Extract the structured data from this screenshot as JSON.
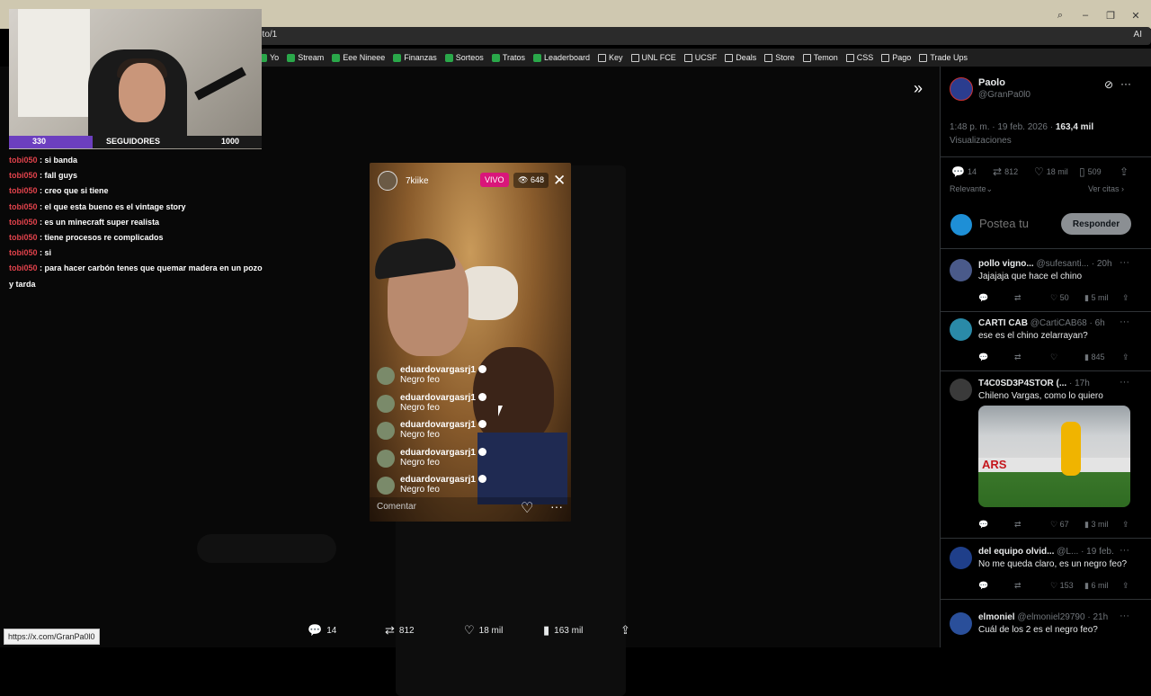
{
  "browser": {
    "url_fragment": "oto/1",
    "ai_label": "AI",
    "bookmarks": [
      "Yo",
      "Stream",
      "Eee Nineee",
      "Finanzas",
      "Sorteos",
      "Tratos",
      "Leaderboard",
      "Key",
      "UNL FCE",
      "UCSF",
      "Deals",
      "Store",
      "Temon",
      "CSS",
      "Pago",
      "Trade Ups"
    ],
    "status_url": "https://x.com/GranPa0l0"
  },
  "stream": {
    "followers_current": "330",
    "followers_label": "SEGUIDORES",
    "followers_goal": "1000",
    "followers_progress": 0.33,
    "chat": [
      {
        "user": "tobi050",
        "text": "si banda"
      },
      {
        "user": "tobi050",
        "text": "fall guys"
      },
      {
        "user": "tobi050",
        "text": "creo que si tiene"
      },
      {
        "user": "tobi050",
        "text": "el que esta bueno es el vintage story"
      },
      {
        "user": "tobi050",
        "text": "es un minecraft super realista"
      },
      {
        "user": "tobi050",
        "text": "tiene procesos re complicados"
      },
      {
        "user": "tobi050",
        "text": "si"
      },
      {
        "user": "tobi050",
        "text": "para hacer carbón tenes que quemar madera en un pozo y tarda"
      }
    ]
  },
  "reel": {
    "username": "7kiike",
    "live_label": "VIVO",
    "viewers": "648",
    "comments": [
      {
        "user": "eduardovargasrj1",
        "text": "Negro feo"
      },
      {
        "user": "eduardovargasrj1",
        "text": "Negro feo"
      },
      {
        "user": "eduardovargasrj1",
        "text": "Negro feo"
      },
      {
        "user": "eduardovargasrj1",
        "text": "Negro feo"
      },
      {
        "user": "eduardovargasrj1",
        "text": "Negro feo"
      }
    ],
    "comment_placeholder": "Comentar"
  },
  "post_actions": {
    "replies": "14",
    "reposts": "812",
    "likes": "18 mil",
    "views": "163 mil"
  },
  "panel": {
    "author_name": "Paolo",
    "author_handle": "@GranPa0l0",
    "timestamp": "1:48 p. m. · 19 feb. 2026 ·",
    "views_count": "163,4 mil",
    "views_label": "Visualizaciones",
    "stats": {
      "replies": "14",
      "reposts": "812",
      "likes": "18 mil",
      "bookmarks": "509"
    },
    "sort_label": "Relevante",
    "quotes_label": "Ver citas",
    "reply_placeholder": "Postea tu",
    "reply_button": "Responder",
    "replies": [
      {
        "name": "pollo vigno...",
        "handle": "@sufesanti...",
        "time": "· 20h",
        "text": "Jajajaja que hace el chino",
        "likes": "50",
        "views": "5 mil",
        "color": "#4a5a8a"
      },
      {
        "name": "CARTI CAB",
        "handle": "@CartiCAB68",
        "time": "· 6h",
        "text": "ese es el chino zelarrayan?",
        "likes": "",
        "views": "845",
        "color": "#2a8aa8"
      },
      {
        "name": "T4C0SD3P4STOR (...",
        "handle": "",
        "time": "· 17h",
        "text": "Chileno Vargas, como lo quiero",
        "likes": "67",
        "views": "3 mil",
        "color": "#3a3a3a",
        "image_text": "ARS"
      },
      {
        "name": "del equipo olvid...",
        "handle": "@L...",
        "time": "· 19 feb.",
        "text": "No me queda claro, es un negro feo?",
        "likes": "153",
        "views": "6 mil",
        "color": "#1f3f8a"
      },
      {
        "name": "elmoniel",
        "handle": "@elmoniel29790",
        "time": "· 21h",
        "text": "Cuál de los 2 es el negro feo?",
        "likes": "",
        "views": "",
        "color": "#2a4f9a"
      }
    ]
  }
}
